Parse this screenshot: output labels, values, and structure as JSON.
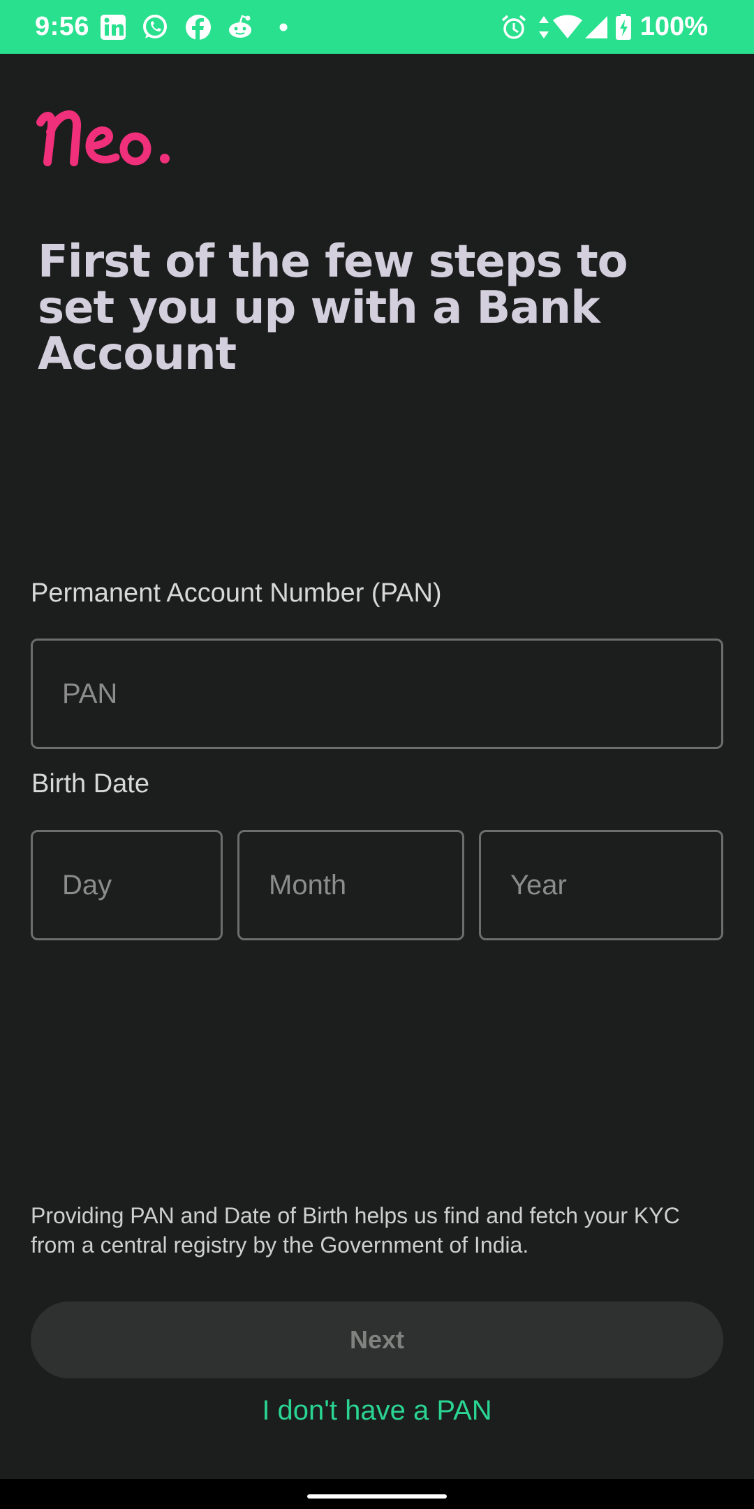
{
  "status_bar": {
    "time": "9:56",
    "battery": "100%",
    "left_icons": [
      "linkedin-icon",
      "whatsapp-icon",
      "facebook-icon",
      "reddit-icon",
      "dot-icon"
    ],
    "right_icons": [
      "alarm-icon",
      "data-arrows-icon",
      "wifi-icon",
      "signal-icon",
      "battery-charging-icon"
    ],
    "background": "#29e08e"
  },
  "logo": {
    "text": "Neo.",
    "color": "#f0307a"
  },
  "headline": "First of the few steps to set you up with a Bank Account",
  "pan": {
    "label": "Permanent Account Number (PAN)",
    "placeholder": "PAN",
    "value": ""
  },
  "birth_date": {
    "label": "Birth Date",
    "day_placeholder": "Day",
    "month_placeholder": "Month",
    "year_placeholder": "Year"
  },
  "helper_text": "Providing PAN and Date of Birth helps us find and fetch your KYC from a central registry by the Government of India.",
  "buttons": {
    "next_label": "Next",
    "no_pan_label": "I don't have a PAN"
  },
  "colors": {
    "background": "#1c1d1d",
    "accent_green": "#2ad492",
    "headline": "#d3cfdd",
    "button_disabled": "#2f3130"
  }
}
